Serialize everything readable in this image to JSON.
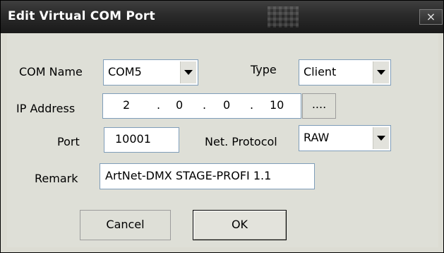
{
  "window": {
    "title": "Edit Virtual COM Port",
    "close_glyph": "×"
  },
  "form": {
    "com_name": {
      "label": "COM Name",
      "value": "COM5"
    },
    "type": {
      "label": "Type",
      "value": "Client"
    },
    "ip_address": {
      "label": "IP Address",
      "octets": [
        "2",
        "0",
        "0",
        "10"
      ],
      "dot": ".",
      "browse_label": "...."
    },
    "port": {
      "label": "Port",
      "value": "10001"
    },
    "net_protocol": {
      "label": "Net. Protocol",
      "value": "RAW"
    },
    "remark": {
      "label": "Remark",
      "value": "ArtNet-DMX STAGE-PROFI 1.1"
    }
  },
  "buttons": {
    "cancel": "Cancel",
    "ok": "OK"
  }
}
